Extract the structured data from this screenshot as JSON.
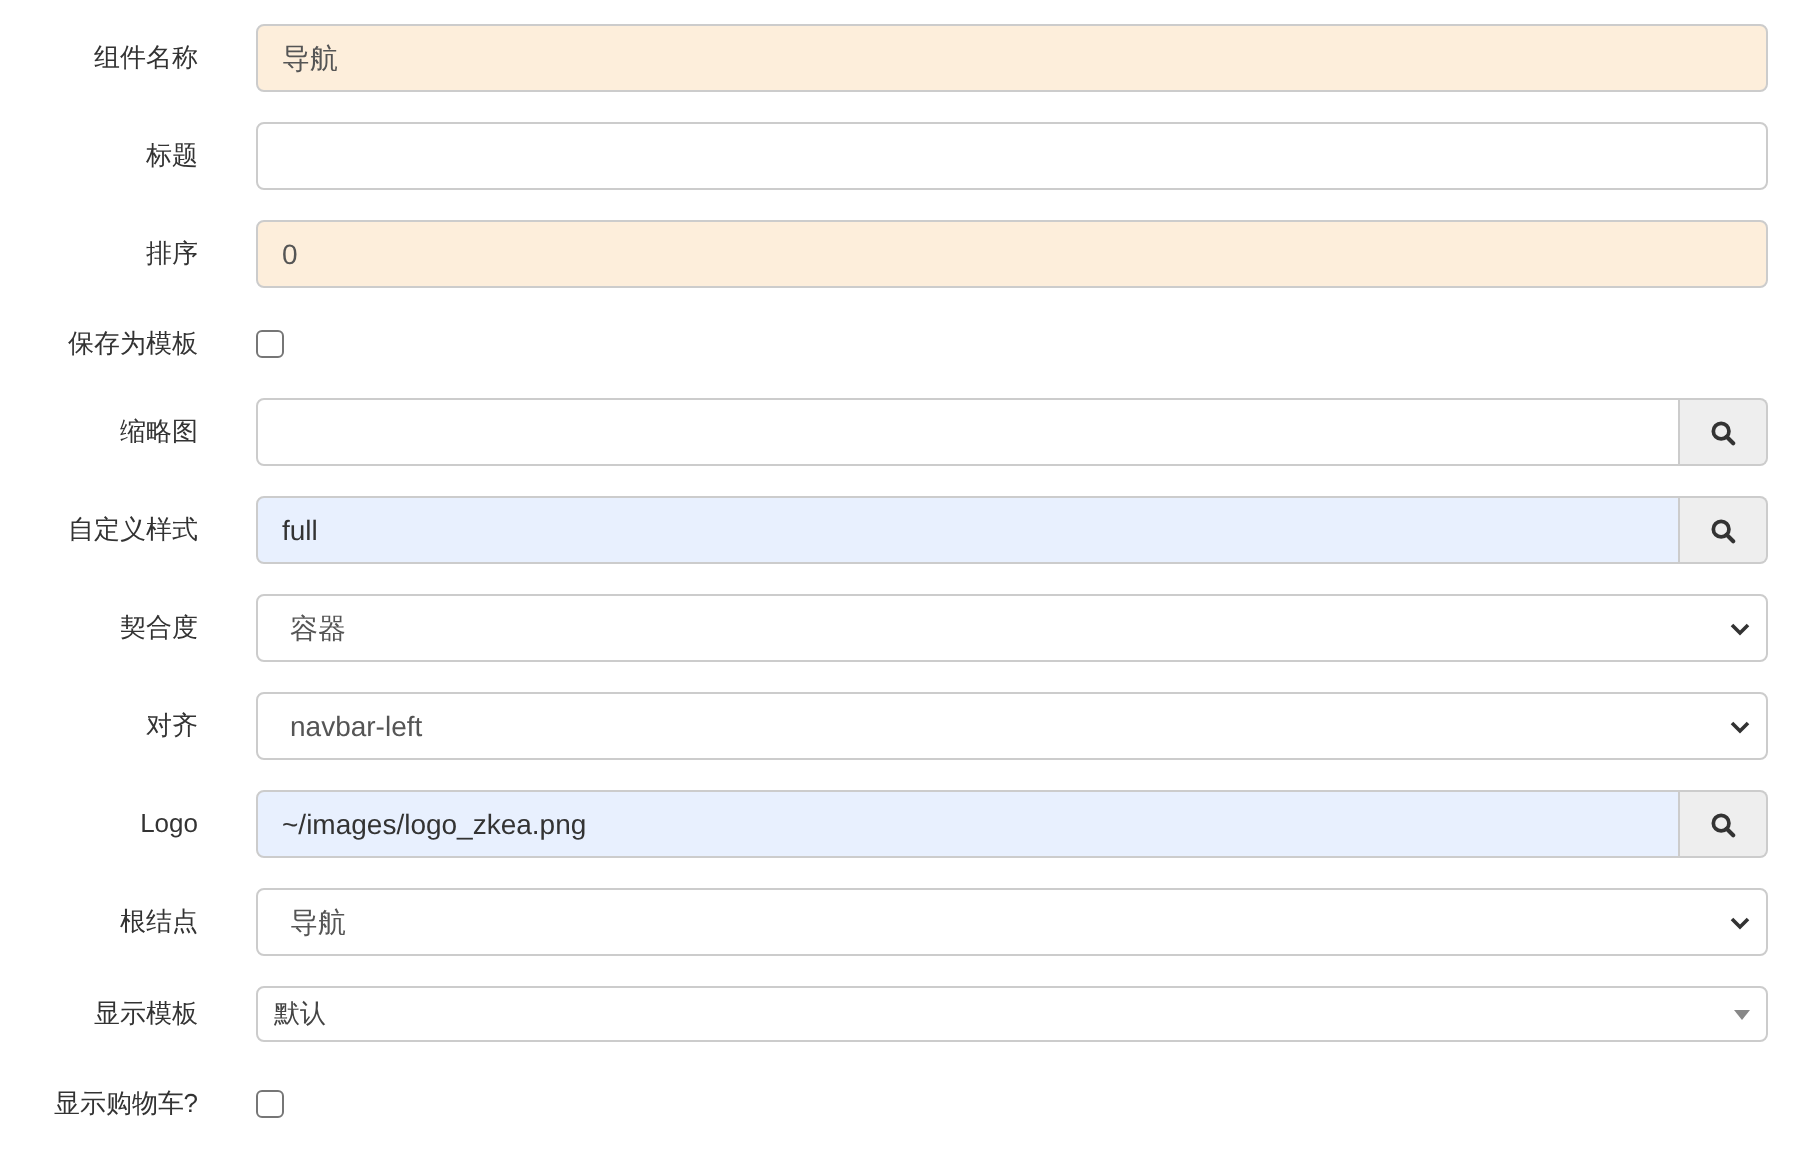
{
  "fields": [
    {
      "kind": "text",
      "label": "组件名称",
      "value": "导航",
      "color": "#fdeedb"
    },
    {
      "kind": "text",
      "label": "标题"
    },
    {
      "kind": "text",
      "label": "排序",
      "value": "0",
      "color": "#fdeedb"
    },
    {
      "kind": "checkbox",
      "label": "保存为模板",
      "checked": false
    },
    {
      "kind": "lookup",
      "label": "缩略图"
    },
    {
      "kind": "lookup",
      "label": "自定义样式",
      "value": "full",
      "color": "#e8f0fe"
    },
    {
      "kind": "select",
      "label": "契合度",
      "value": "容器"
    },
    {
      "kind": "select",
      "label": "对齐",
      "value": "navbar-left"
    },
    {
      "kind": "lookup",
      "label": "Logo",
      "value": "~/images/logo_zkea.png",
      "color": "#e8f0fe"
    },
    {
      "kind": "select",
      "label": "根结点",
      "value": "导航"
    },
    {
      "kind": "combo",
      "label": "显示模板",
      "value": "默认"
    },
    {
      "kind": "checkbox",
      "label": "显示购物车?",
      "checked": false
    }
  ]
}
